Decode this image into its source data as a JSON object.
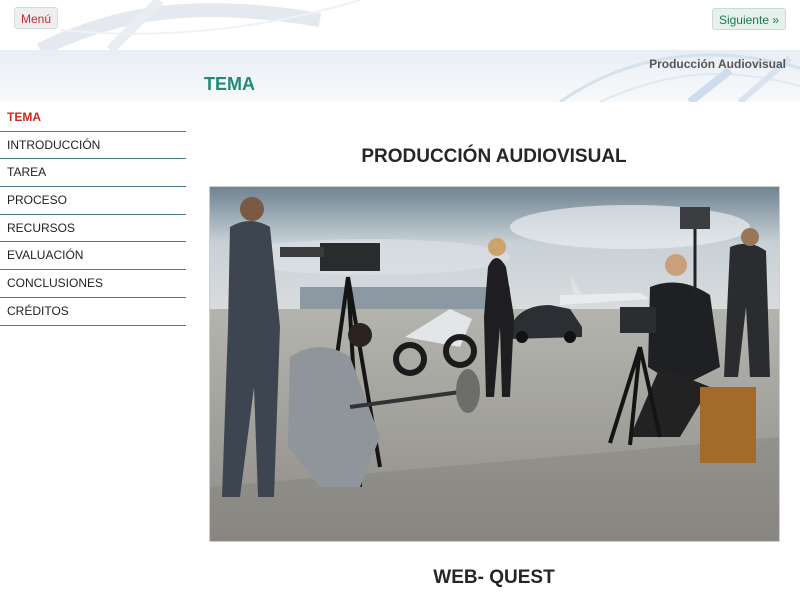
{
  "topbar": {
    "menu_label": "Menú",
    "next_label": "Siguiente »"
  },
  "header": {
    "subject": "Producción Audiovisual",
    "section": "TEMA"
  },
  "sidebar": {
    "items": [
      {
        "label": "TEMA",
        "active": true
      },
      {
        "label": "INTRODUCCIÓN",
        "active": false
      },
      {
        "label": "TAREA",
        "active": false
      },
      {
        "label": "PROCESO",
        "active": false
      },
      {
        "label": "RECURSOS",
        "active": false
      },
      {
        "label": "EVALUACIÓN",
        "active": false
      },
      {
        "label": "CONCLUSIONES",
        "active": false
      },
      {
        "label": "CRÉDITOS",
        "active": false
      }
    ]
  },
  "main": {
    "heading": "PRODUCCIÓN AUDIOVISUAL",
    "footer_title": "WEB- QUEST"
  },
  "colors": {
    "accent_red": "#cc2a1d",
    "accent_teal": "#1f8a78",
    "nav_rule": "#4a7c8a",
    "next_green": "#1a7a4f"
  }
}
